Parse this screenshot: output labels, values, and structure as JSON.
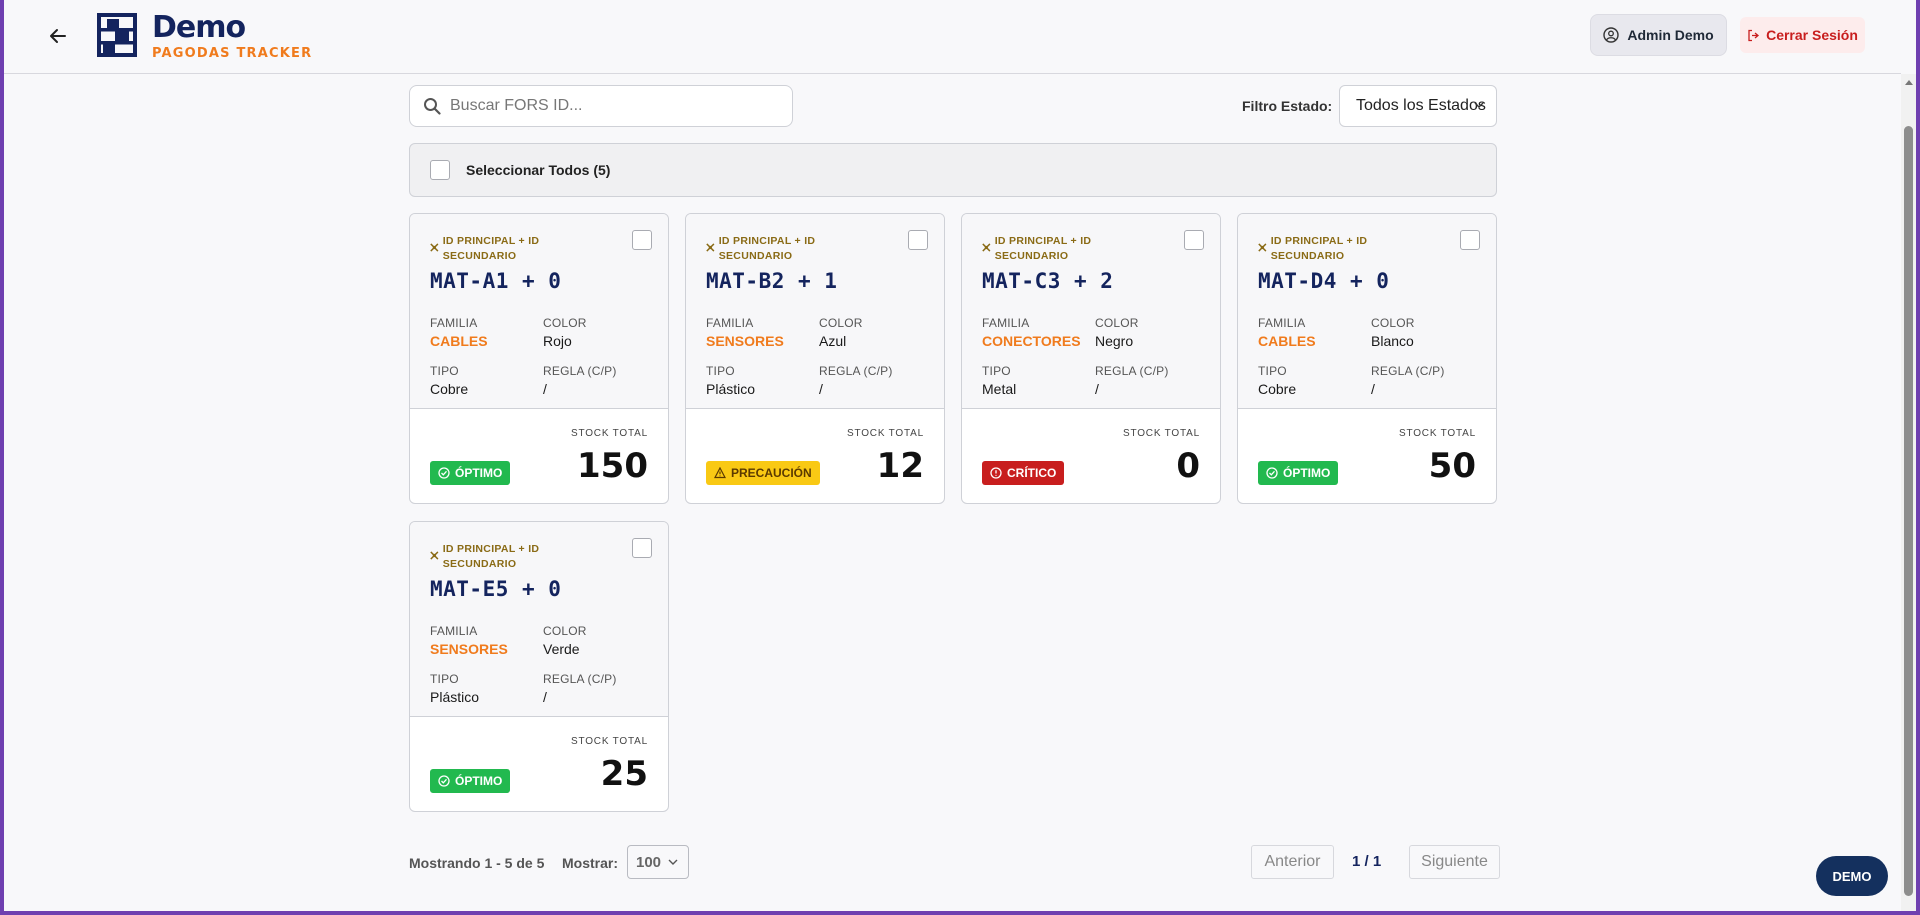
{
  "header": {
    "brand_title": "Demo",
    "brand_subtitle": "PAGODAS TRACKER",
    "user_label": "Admin Demo",
    "logout_label": "Cerrar Sesión"
  },
  "toolbar": {
    "search_placeholder": "Buscar FORS ID...",
    "filter_label": "Filtro Estado:",
    "filter_value": "Todos los Estados",
    "select_all_label": "Seleccionar Todos (5)"
  },
  "card_labels": {
    "id_tag": "ID PRINCIPAL + ID SECUNDARIO",
    "familia": "FAMILIA",
    "color": "COLOR",
    "tipo": "TIPO",
    "regla": "REGLA (C/P)",
    "stock_total": "STOCK TOTAL"
  },
  "cards": [
    {
      "code": "MAT-A1 + 0",
      "familia": "CABLES",
      "color": "Rojo",
      "tipo": "Cobre",
      "regla": "/",
      "stock": "150",
      "status": "ÓPTIMO",
      "status_type": "ok"
    },
    {
      "code": "MAT-B2 + 1",
      "familia": "SENSORES",
      "color": "Azul",
      "tipo": "Plástico",
      "regla": "/",
      "stock": "12",
      "status": "PRECAUCIÓN",
      "status_type": "warn"
    },
    {
      "code": "MAT-C3 + 2",
      "familia": "CONECTORES",
      "color": "Negro",
      "tipo": "Metal",
      "regla": "/",
      "stock": "0",
      "status": "CRÍTICO",
      "status_type": "crit"
    },
    {
      "code": "MAT-D4 + 0",
      "familia": "CABLES",
      "color": "Blanco",
      "tipo": "Cobre",
      "regla": "/",
      "stock": "50",
      "status": "ÓPTIMO",
      "status_type": "ok"
    },
    {
      "code": "MAT-E5 + 0",
      "familia": "SENSORES",
      "color": "Verde",
      "tipo": "Plástico",
      "regla": "/",
      "stock": "25",
      "status": "ÓPTIMO",
      "status_type": "ok"
    }
  ],
  "footer": {
    "showing": "Mostrando 1 - 5 de 5",
    "show_label": "Mostrar:",
    "per_page": "100",
    "prev_label": "Anterior",
    "page_info": "1 / 1",
    "next_label": "Siguiente"
  },
  "demo_badge": "DEMO",
  "colors": {
    "brand": "#14245e",
    "accent": "#f07b1d",
    "ok": "#22b94f",
    "warn": "#f9c914",
    "crit": "#c81e1e"
  },
  "icons": {
    "back": "arrow-left-icon",
    "logo": "shelf-icon",
    "user": "user-circle-icon",
    "logout": "logout-icon",
    "search": "search-icon",
    "tag": "key-icon",
    "ok": "check-circle-icon",
    "warn": "warning-triangle-icon",
    "crit": "alert-circle-icon"
  }
}
